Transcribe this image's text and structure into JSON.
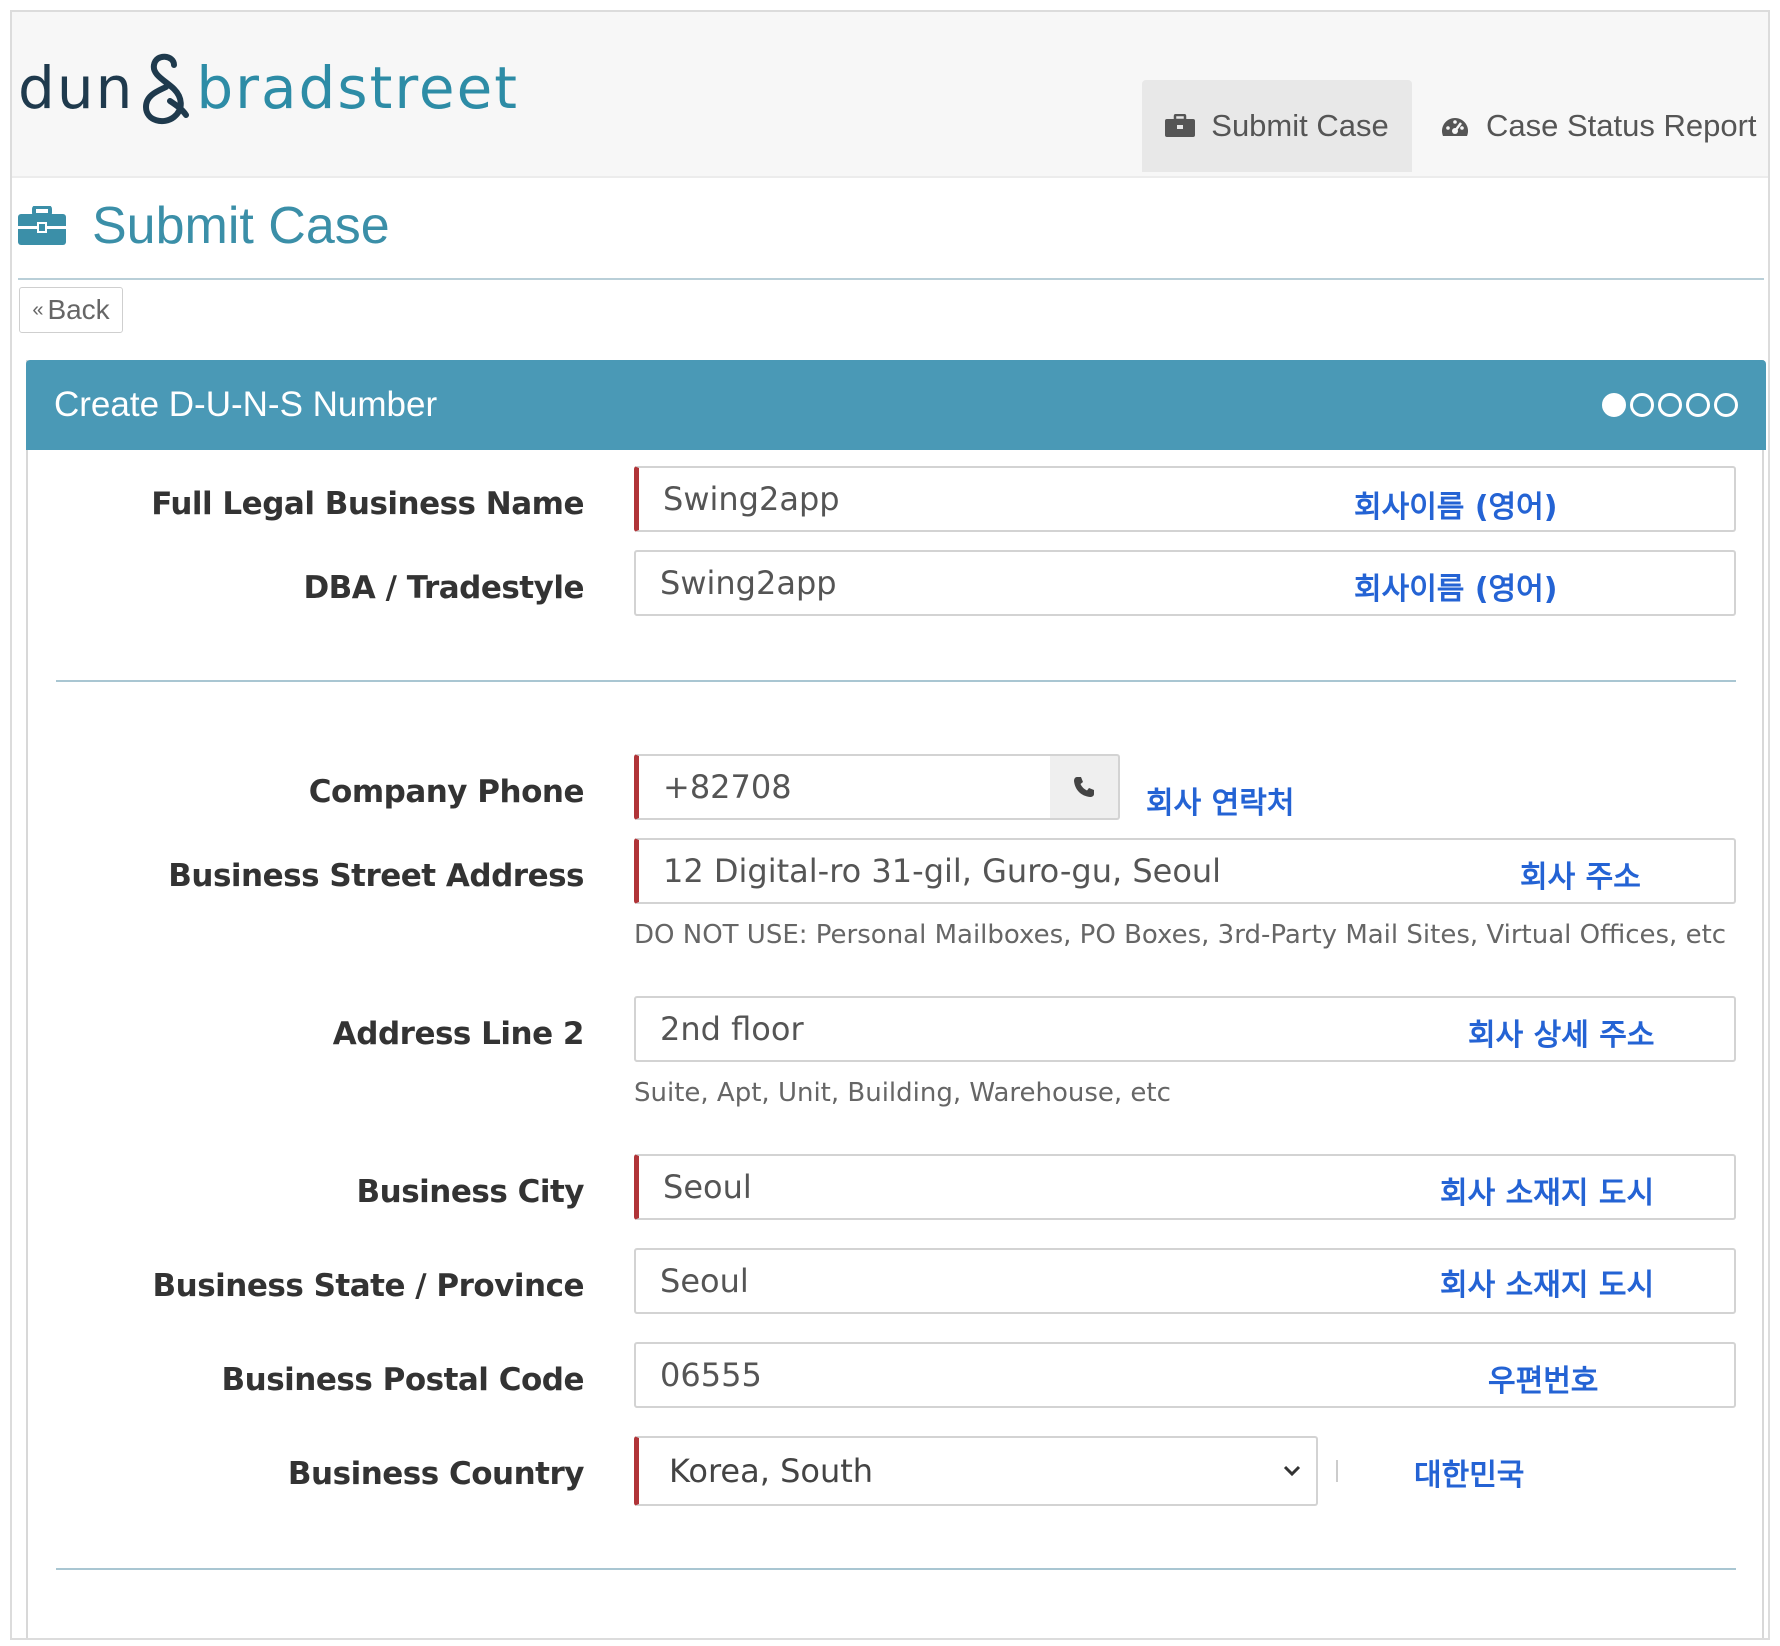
{
  "brand": {
    "part1": "dun",
    "part2": "bradstreet"
  },
  "nav": [
    {
      "label": "Submit Case",
      "icon": "briefcase-icon",
      "active": true
    },
    {
      "label": "Case Status Report",
      "icon": "dashboard-icon",
      "active": false
    }
  ],
  "page": {
    "title": "Submit Case",
    "back_label": "Back"
  },
  "panel": {
    "title": "Create D-U-N-S Number",
    "steps_total": 5,
    "step_current": 1
  },
  "form": {
    "legal_name": {
      "label": "Full Legal Business Name",
      "value": "Swing2app",
      "note": "회사이름 (영어)"
    },
    "dba": {
      "label": "DBA / Tradestyle",
      "value": "Swing2app",
      "note": "회사이름 (영어)"
    },
    "phone": {
      "label": "Company Phone",
      "value": "+82708",
      "note": "회사 연락처"
    },
    "street": {
      "label": "Business Street Address",
      "value": "12 Digital-ro 31-gil, Guro-gu, Seoul",
      "note": "회사 주소",
      "hint": "DO NOT USE: Personal Mailboxes, PO Boxes, 3rd-Party Mail Sites, Virtual Offices, etc"
    },
    "line2": {
      "label": "Address Line 2",
      "value": "2nd floor",
      "note": "회사 상세 주소",
      "hint": "Suite, Apt, Unit, Building, Warehouse, etc"
    },
    "city": {
      "label": "Business City",
      "value": "Seoul",
      "note": "회사 소재지 도시"
    },
    "state": {
      "label": "Business State / Province",
      "value": "Seoul",
      "note": "회사 소재지 도시"
    },
    "postal": {
      "label": "Business Postal Code",
      "value": "06555",
      "note": "우편번호"
    },
    "country": {
      "label": "Business Country",
      "value": "Korea, South",
      "note": "대한민국"
    }
  },
  "colors": {
    "accent": "#4a99b6",
    "required": "#b03438",
    "note": "#2463d4"
  }
}
